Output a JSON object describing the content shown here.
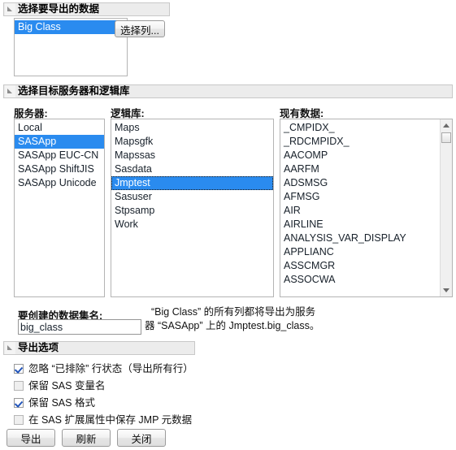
{
  "sections": {
    "select_data": {
      "title": "选择要导出的数据",
      "data_list": [
        {
          "label": "Big Class",
          "selected": true
        }
      ],
      "select_columns_button": "选择列..."
    },
    "select_target": {
      "title": "选择目标服务器和逻辑库",
      "server": {
        "label": "服务器:",
        "items": [
          {
            "label": "Local",
            "selected": false
          },
          {
            "label": "SASApp",
            "selected": true
          },
          {
            "label": "SASApp EUC-CN",
            "selected": false
          },
          {
            "label": "SASApp ShiftJIS",
            "selected": false
          },
          {
            "label": "SASApp Unicode",
            "selected": false
          }
        ]
      },
      "library": {
        "label": "逻辑库:",
        "items": [
          {
            "label": "Maps",
            "selected": false
          },
          {
            "label": "Mapsgfk",
            "selected": false
          },
          {
            "label": "Mapssas",
            "selected": false
          },
          {
            "label": "Sasdata",
            "selected": false
          },
          {
            "label": "Jmptest",
            "selected": true
          },
          {
            "label": "Sasuser",
            "selected": false
          },
          {
            "label": "Stpsamp",
            "selected": false
          },
          {
            "label": "Work",
            "selected": false
          }
        ]
      },
      "existing": {
        "label": "现有数据:",
        "items": [
          {
            "label": "_CMPIDX_",
            "selected": false
          },
          {
            "label": "_RDCMPIDX_",
            "selected": false
          },
          {
            "label": "AACOMP",
            "selected": false
          },
          {
            "label": "AARFM",
            "selected": false
          },
          {
            "label": "ADSMSG",
            "selected": false
          },
          {
            "label": "AFMSG",
            "selected": false
          },
          {
            "label": "AIR",
            "selected": false
          },
          {
            "label": "AIRLINE",
            "selected": false
          },
          {
            "label": "ANALYSIS_VAR_DISPLAY",
            "selected": false
          },
          {
            "label": "APPLIANC",
            "selected": false
          },
          {
            "label": "ASSCMGR",
            "selected": false
          },
          {
            "label": "ASSOCWA",
            "selected": false
          }
        ]
      }
    },
    "dataset_name": {
      "label": "要创建的数据集名:",
      "value": "big_class",
      "placeholder": ""
    },
    "description": {
      "line1": "“Big Class” 的所有列都将导出为服务",
      "line2": "器 “SASApp” 上的 Jmptest.big_class。"
    },
    "export_options": {
      "title": "导出选项",
      "options": [
        {
          "label": "忽略 “已排除” 行状态（导出所有行）",
          "checked": true
        },
        {
          "label": "保留 SAS 变量名",
          "checked": false
        },
        {
          "label": "保留 SAS 格式",
          "checked": true
        },
        {
          "label": "在 SAS 扩展属性中保存 JMP 元数据",
          "checked": false
        }
      ]
    }
  },
  "buttons": {
    "export": "导出",
    "refresh": "刷新",
    "close": "关闭"
  },
  "colors": {
    "selection_blue": "#2a8bef",
    "header_gray": "#ececec",
    "panel_bg": "#ffffff"
  }
}
